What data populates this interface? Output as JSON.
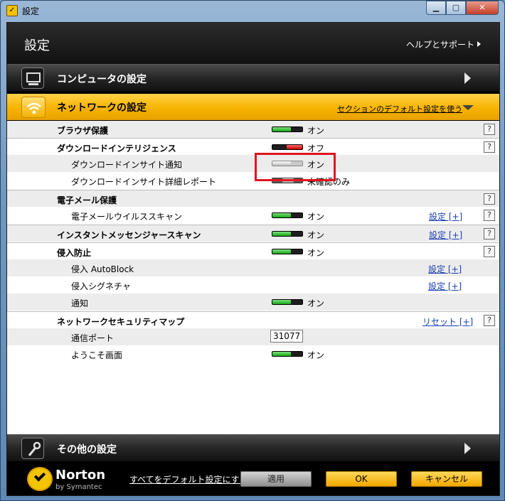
{
  "window": {
    "title": "設定",
    "icon": "norton-app-icon",
    "buttons": [
      "minimize",
      "maximize",
      "close"
    ]
  },
  "header": {
    "title": "設定",
    "help_link": "ヘルプとサポート"
  },
  "sections": {
    "computer": {
      "label": "コンピュータの設定",
      "icon": "monitor-icon"
    },
    "network": {
      "label": "ネットワークの設定",
      "icon": "wifi-icon",
      "defaults_link": "セクションのデフォルト設定を使う"
    },
    "other": {
      "label": "その他の設定",
      "icon": "wrench-icon"
    }
  },
  "rows": [
    {
      "label": "ブラウザ保護",
      "state": "オン",
      "help": "?"
    },
    {
      "label": "ダウンロードインテリジェンス",
      "state": "オフ",
      "help": "?"
    },
    {
      "label": "ダウンロードインサイト通知",
      "state": "オン"
    },
    {
      "label": "ダウンロードインサイト詳細レポート",
      "state": "未確認のみ"
    },
    {
      "label": "電子メール保護",
      "help": "?"
    },
    {
      "label": "電子メールウイルススキャン",
      "state": "オン",
      "link": "設定 [+]",
      "help": "?"
    },
    {
      "label": "インスタントメッセンジャースキャン",
      "state": "オン",
      "link": "設定 [+]",
      "help": "?"
    },
    {
      "label": "侵入防止",
      "state": "オン",
      "help": "?"
    },
    {
      "label": "侵入 AutoBlock",
      "link": "設定 [+]"
    },
    {
      "label": "侵入シグネチャ",
      "link": "設定 [+]"
    },
    {
      "label": "通知",
      "state": "オン"
    },
    {
      "label": "ネットワークセキュリティマップ",
      "link": "リセット [+]",
      "help": "?"
    },
    {
      "label": "通信ポート",
      "value": "31077"
    },
    {
      "label": "ようこそ画面",
      "state": "オン"
    }
  ],
  "footer": {
    "brand": "Norton",
    "brand_sub": "by Symantec",
    "defaults_link": "すべてをデフォルト設定にする",
    "apply": "適用",
    "ok": "OK",
    "cancel": "キャンセル"
  },
  "colors": {
    "accent": "#f6b400",
    "toggle_on": "#14a814",
    "toggle_off": "#c80000",
    "highlight": "#e1141e",
    "link": "#1a3fb0"
  }
}
